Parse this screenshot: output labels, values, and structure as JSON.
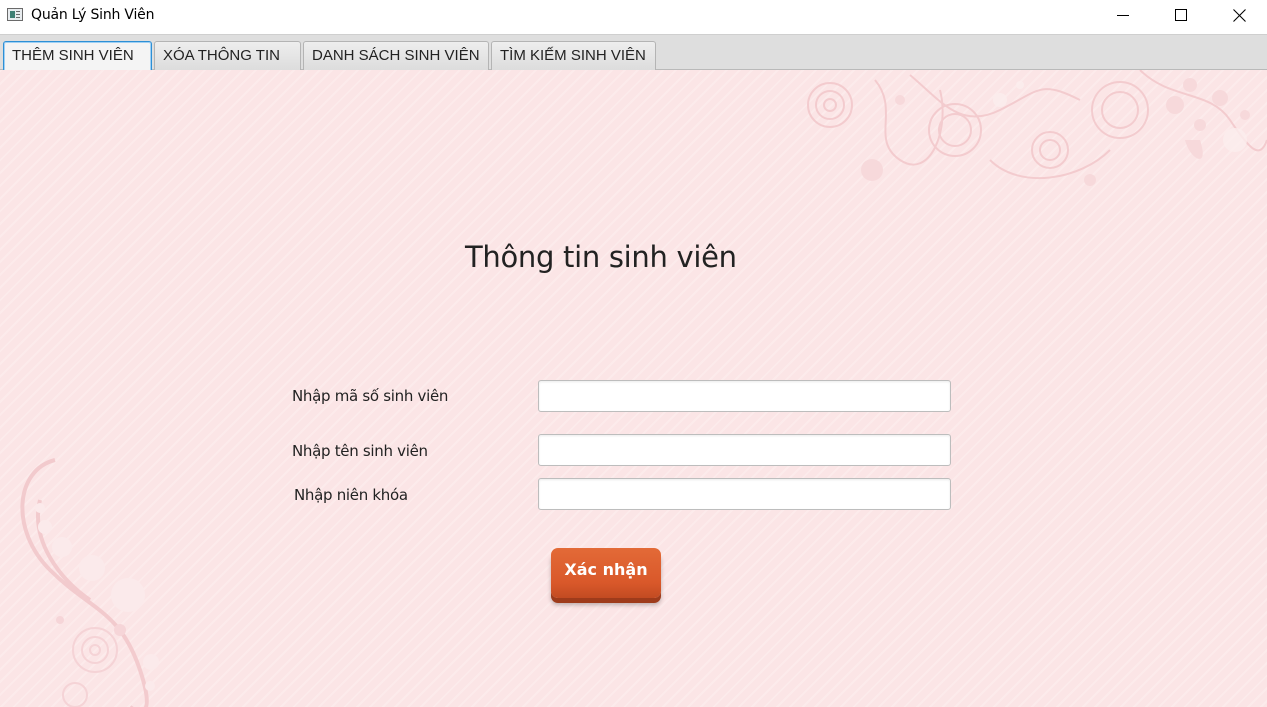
{
  "window": {
    "title": "Quản Lý Sinh Viên",
    "icon": "app-window-icon",
    "controls": [
      "minimize-icon",
      "maximize-icon",
      "close-icon"
    ]
  },
  "tabs": [
    {
      "label": "THÊM SINH VIÊN",
      "active": true
    },
    {
      "label": "XÓA THÔNG TIN",
      "active": false
    },
    {
      "label": "DANH SÁCH SINH VIÊN",
      "active": false
    },
    {
      "label": "TÌM KIẾM SINH VIÊN",
      "active": false
    }
  ],
  "form": {
    "title": "Thông tin sinh viên",
    "fields": [
      {
        "label": "Nhập mã số sinh viên",
        "value": ""
      },
      {
        "label": "Nhập tên sinh viên",
        "value": ""
      },
      {
        "label": "Nhập niên khóa",
        "value": ""
      }
    ],
    "submit_label": "Xác nhận"
  },
  "colors": {
    "background": "#fbe5e6",
    "button": "#d9582a",
    "active_tab_border": "#2d8fd5"
  }
}
